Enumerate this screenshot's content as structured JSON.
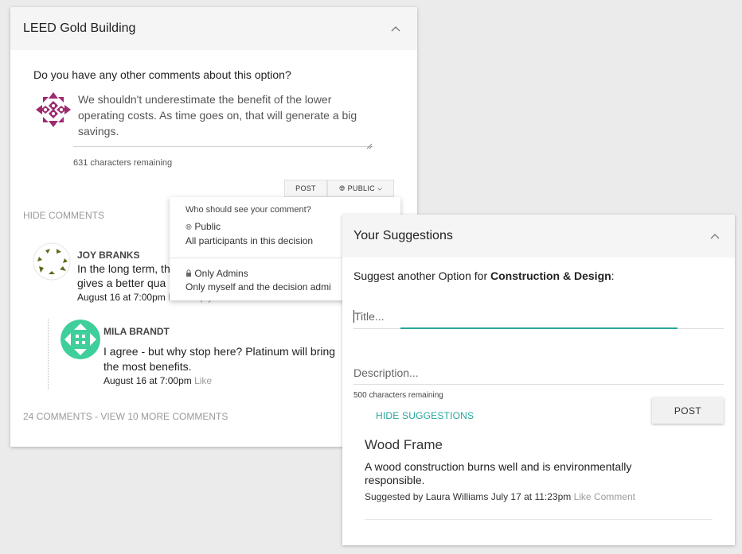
{
  "left_card": {
    "title": "LEED Gold Building",
    "question": "Do you have any other comments about this option?",
    "comment_value": "We shouldn't underestimate the benefit of the lower operating costs. As time goes on, that will generate a big savings.",
    "chars_remaining": "631 characters remaining",
    "post_label": "POST",
    "visibility_label": "PUBLIC",
    "hide_comments": "HIDE COMMENTS",
    "comments": [
      {
        "author": "JOY BRANKS",
        "text_line1": "In the long term, th",
        "text_line2": "gives a better qua",
        "date": "August 16 at 7:00pm",
        "like": "Like",
        "reply": "Reply"
      },
      {
        "author": "MILA BRANDT",
        "text_line1": "I agree - but why stop here? Platinum will bring",
        "text_line2": "the most benefits.",
        "date": "August 16 at 7:00pm",
        "like": "Like"
      }
    ],
    "footer": "24 COMMENTS - VIEW 10 MORE COMMENTS"
  },
  "visibility_dropdown": {
    "header": "Who should see your comment?",
    "options": [
      {
        "label": "Public",
        "description": "All participants in this decision"
      },
      {
        "label": "Only Admins",
        "description": "Only myself and the decision admi"
      }
    ]
  },
  "right_card": {
    "title": "Your Suggestions",
    "prompt_prefix": "Suggest another Option for ",
    "prompt_bold": "Construction & Design",
    "prompt_suffix": ":",
    "title_placeholder": "Title...",
    "description_placeholder": "Description...",
    "chars_remaining": "500 characters remaining",
    "hide_suggestions": "HIDE SUGGESTIONS",
    "post_label": "POST",
    "suggestion": {
      "name": "Wood Frame",
      "description": "A wood construction burns well and is environmentally responsible.",
      "byline": "Suggested by Laura Williams July 17 at 11:23pm",
      "like": "Like",
      "comment": "Comment"
    }
  },
  "colors": {
    "accent": "#26a69a",
    "avatar_purple": "#9c2a6e",
    "avatar_green": "#5a6b1e",
    "avatar_teal": "#3ecf9a"
  }
}
